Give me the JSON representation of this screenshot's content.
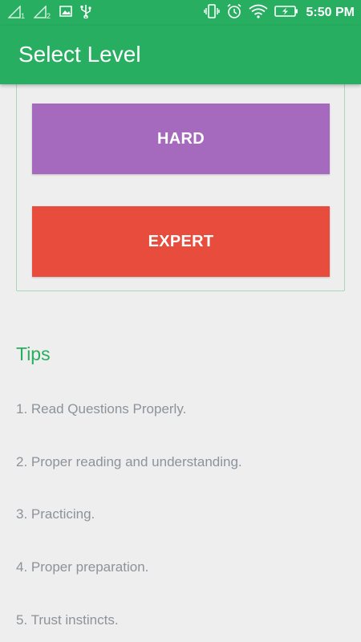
{
  "status_bar": {
    "time": "5:50 PM",
    "sim1": "1",
    "sim2": "2",
    "icons": [
      "signal-icon",
      "signal-icon",
      "image-icon",
      "usb-icon",
      "vibrate-icon",
      "alarm-icon",
      "wifi-icon",
      "battery-charging-icon"
    ]
  },
  "app_bar": {
    "title": "Select Level"
  },
  "levels": {
    "hard_label": "HARD",
    "expert_label": "EXPERT"
  },
  "tips": {
    "title": "Tips",
    "items": [
      "1. Read Questions Properly.",
      "2. Proper reading and understanding.",
      "3. Practicing.",
      "4. Proper preparation.",
      "5. Trust instincts."
    ]
  },
  "colors": {
    "primary": "#27ae60",
    "hard": "#a569bd",
    "expert": "#e74c3c",
    "background": "#eeeeee",
    "tip_text": "#8c939a"
  }
}
